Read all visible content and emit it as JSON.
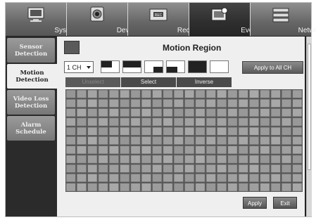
{
  "tabs": [
    {
      "label": "System",
      "icon": "monitor-icon"
    },
    {
      "label": "Device",
      "icon": "camera-icon"
    },
    {
      "label": "Record",
      "icon": "record-icon"
    },
    {
      "label": "Event",
      "icon": "event-icon"
    },
    {
      "label": "Network",
      "icon": "network-icon"
    }
  ],
  "sidebar": {
    "items": [
      {
        "label": "Sensor Detection"
      },
      {
        "label": "Motion Detection",
        "active": true
      },
      {
        "label": "Video Loss Detection"
      },
      {
        "label": "Alarm Schedule"
      }
    ]
  },
  "content": {
    "title": "Motion Region",
    "channel": "1 CH",
    "apply_all_label": "Apply to All CH",
    "select_buttons": [
      "Unselect",
      "Select",
      "Inverse"
    ],
    "apply_label": "Apply",
    "exit_label": "Exit",
    "grid": {
      "columns": 22,
      "rows": 11
    }
  },
  "colors": {
    "accent": "#222222",
    "panel": "#efefef",
    "tab": "#707070"
  }
}
